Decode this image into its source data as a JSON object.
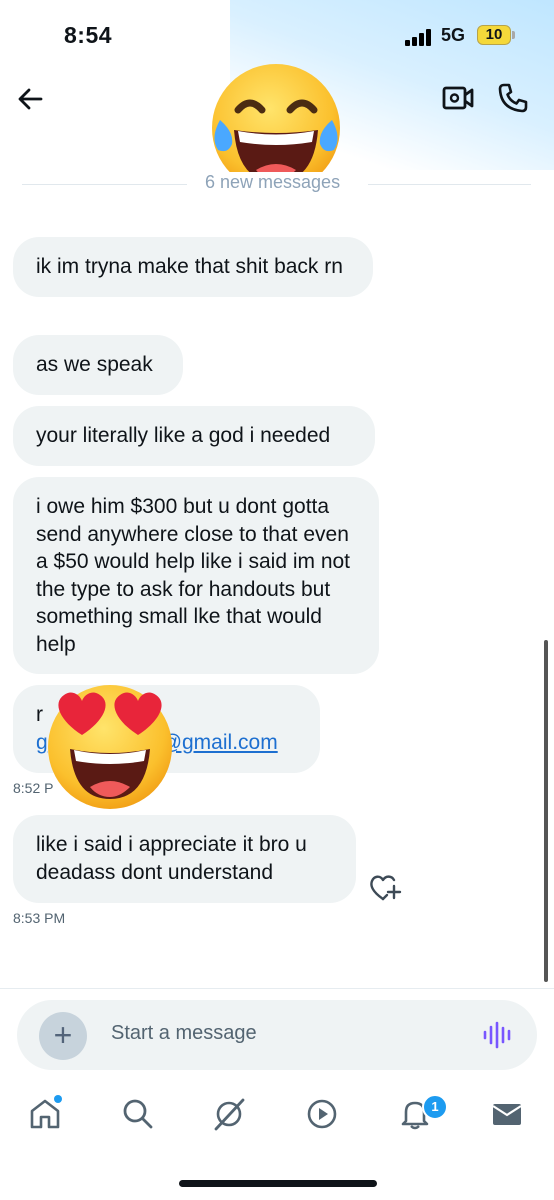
{
  "status_bar": {
    "time": "8:54",
    "network": "5G",
    "battery": "10"
  },
  "header": {
    "avatar_icon": "laughing-crying-emoji",
    "unread_divider": "6 new messages"
  },
  "messages": [
    {
      "text": "ik im tryna make that shit back rn"
    },
    {
      "text": "as we speak"
    },
    {
      "text": "your literally like a god i needed"
    },
    {
      "text": "i owe him $300 but u dont gotta send anywhere close to that even a $50 would help like i said im not the type to ask for handouts but something small lke that would help"
    },
    {
      "text_line1": "r",
      "email_visible_start": "g",
      "email_visible_end": "@gmail.com",
      "timestamp": "8:52 P"
    },
    {
      "text": "like i said i appreciate it bro u deadass dont understand",
      "timestamp": "8:53 PM"
    }
  ],
  "composer": {
    "placeholder": "Start a message"
  },
  "nav": {
    "notifications_badge": "1",
    "items": [
      "home-icon",
      "search-icon",
      "grok-icon",
      "video-icon",
      "notifications-icon",
      "messages-icon"
    ]
  },
  "colors": {
    "accent": "#1d9bf0",
    "bubble": "#eff3f4",
    "link": "#1d6fd0",
    "voice": "#7856ff"
  }
}
